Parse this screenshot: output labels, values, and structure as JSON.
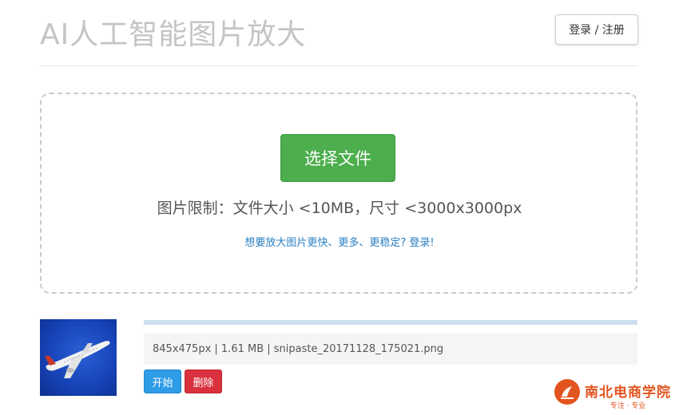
{
  "header": {
    "title": "AI人工智能图片放大",
    "login_label": "登录 / 注册"
  },
  "upload": {
    "choose_label": "选择文件",
    "limit_text": "图片限制：文件大小 <10MB，尺寸 <3000x3000px",
    "upgrade_link": "想要放大图片更快、更多、更稳定? 登录!"
  },
  "file_item": {
    "info": "845x475px | 1.61 MB | snipaste_20171128_175021.png",
    "progress_percent": 100,
    "start_label": "开始",
    "delete_label": "删除"
  },
  "watermark": {
    "name": "南北电商学院",
    "tagline": "专注 · 专业"
  },
  "colors": {
    "choose_button": "#4cae4c",
    "start_button": "#2e9ce6",
    "delete_button": "#d9313d",
    "link": "#2a7fc1",
    "watermark": "#e2541f"
  },
  "icons": {
    "thumbnail": "airplane-image",
    "watermark_logo": "brand-logo-icon"
  }
}
